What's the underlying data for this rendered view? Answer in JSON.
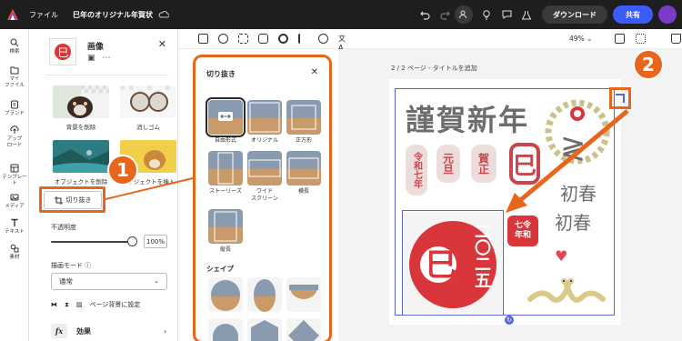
{
  "app": {
    "file_menu": "ファイル",
    "doc_title": "巳年のオリジナル年賀状",
    "download_label": "ダウンロード",
    "share_label": "共有"
  },
  "rail": [
    {
      "label": "検索",
      "icon": "search-icon"
    },
    {
      "label": "マイ\nファイル",
      "icon": "folder-icon"
    },
    {
      "label": "ブランド",
      "icon": "brand-icon"
    },
    {
      "label": "アップ\nロード",
      "icon": "upload-icon"
    },
    {
      "label": "テンプレート",
      "icon": "template-icon"
    },
    {
      "label": "メディア",
      "icon": "media-icon"
    },
    {
      "label": "テキスト",
      "icon": "text-icon"
    },
    {
      "label": "素材",
      "icon": "elements-icon"
    }
  ],
  "panel": {
    "title": "画像",
    "tools": [
      {
        "label": "背景を削除"
      },
      {
        "label": "消しゴム"
      },
      {
        "label": "オブジェクトを削除"
      },
      {
        "label": "オブジェクトを挿入"
      }
    ],
    "crop_label": "切り抜き",
    "opacity_label": "不透明度",
    "opacity_value": "100%",
    "opacity_level": 1.0,
    "blend_label": "描画モード",
    "blend_value": "通常",
    "set_background_label": "ページ背景に設定",
    "effects_label": "効果",
    "fx_glyph": "fx"
  },
  "flyout": {
    "title": "切り抜き",
    "items": [
      {
        "label": "自由形式"
      },
      {
        "label": "オリジナル"
      },
      {
        "label": "正方形"
      },
      {
        "label": "ストーリーズ"
      },
      {
        "label": "ワイド\nスクリーン"
      },
      {
        "label": "横長"
      },
      {
        "label": "縦長"
      }
    ],
    "shapes_label": "シェイプ"
  },
  "toolbar": {
    "zoom": "49%"
  },
  "canvas": {
    "page_label": "2 / 2 ページ - タイトルを追加",
    "heading": "謹賀新年",
    "stamps": [
      "令和七年",
      "元旦",
      "賀正",
      "巳"
    ],
    "big_char": "巳",
    "vertical_text": "二〇二五",
    "reiwa_red": "七令\n年和",
    "hatsuharu_1": "初春",
    "hatsuharu_2": "初春"
  },
  "callouts": [
    "1",
    "2"
  ],
  "colors": {
    "accent_orange": "#e8651c",
    "share_blue": "#3b5bfd",
    "stamp_red": "#c9474c",
    "sun_red": "#d8363a"
  }
}
